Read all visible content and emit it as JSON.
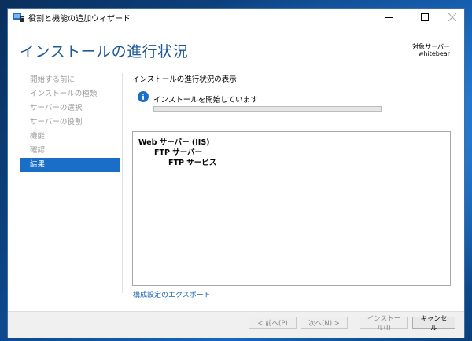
{
  "window": {
    "title": "役割と機能の追加ウィザード"
  },
  "header": {
    "title": "インストールの進行状況",
    "target_label": "対象サーバー",
    "target_server": "whitebear"
  },
  "sidebar": {
    "items": [
      {
        "label": "開始する前に",
        "active": false
      },
      {
        "label": "インストールの種類",
        "active": false
      },
      {
        "label": "サーバーの選択",
        "active": false
      },
      {
        "label": "サーバーの役割",
        "active": false
      },
      {
        "label": "機能",
        "active": false
      },
      {
        "label": "確認",
        "active": false
      },
      {
        "label": "結果",
        "active": true
      }
    ]
  },
  "content": {
    "heading": "インストールの進行状況の表示",
    "status": "インストールを開始しています",
    "progress_fraction": 0.0,
    "results_tree": [
      {
        "label": "Web サーバー (IIS)",
        "level": 0
      },
      {
        "label": "FTP サーバー",
        "level": 1
      },
      {
        "label": "FTP サービス",
        "level": 2
      }
    ],
    "export_link": "構成設定のエクスポート"
  },
  "footer": {
    "prev_label": "< 前へ(P)",
    "next_label": "次へ(N) >",
    "install_label": "インストール(I)",
    "cancel_label": "キャンセル"
  },
  "colors": {
    "accent": "#1a6ec7",
    "title_blue": "#1e5a98",
    "link": "#1a5fb4",
    "progress": "#06b025"
  }
}
